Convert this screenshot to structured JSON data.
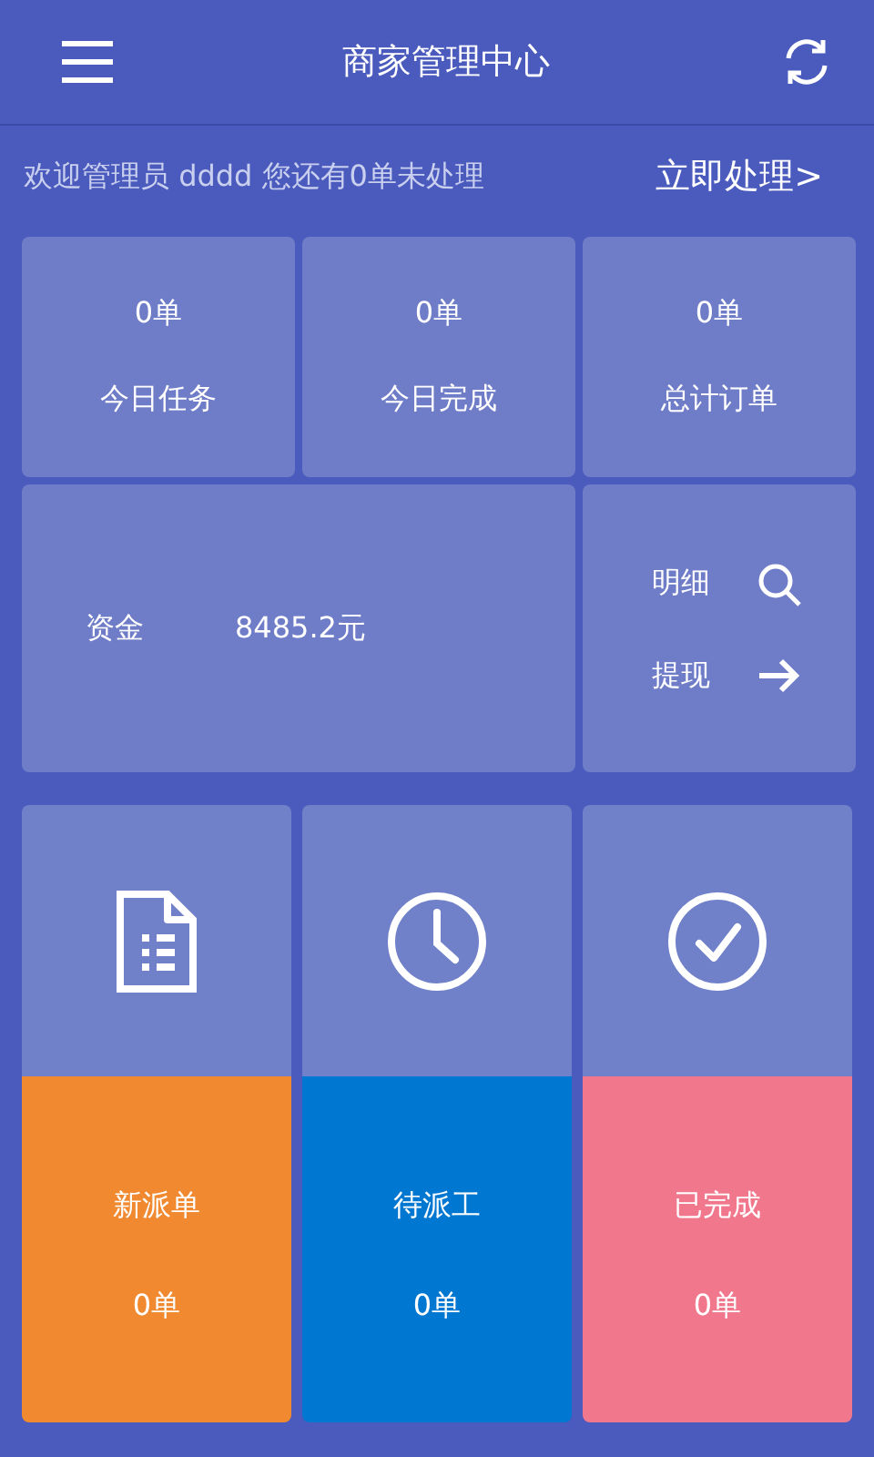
{
  "header": {
    "title": "商家管理中心"
  },
  "notice": {
    "text": "欢迎管理员 dddd 您还有0单未处理",
    "action": "立即处理>"
  },
  "stats": [
    {
      "value": "0单",
      "label": "今日任务"
    },
    {
      "value": "0单",
      "label": "今日完成"
    },
    {
      "value": "0单",
      "label": "总计订单"
    }
  ],
  "funds": {
    "label": "资金",
    "amount": "8485.2元",
    "links": [
      {
        "label": "明细",
        "kind": "search"
      },
      {
        "label": "提现",
        "kind": "arrow"
      }
    ]
  },
  "tiles": [
    {
      "kind": "document",
      "label": "新派单",
      "count": "0单",
      "color": "#f0892f"
    },
    {
      "kind": "clock",
      "label": "待派工",
      "count": "0单",
      "color": "#0077d0"
    },
    {
      "kind": "check",
      "label": "已完成",
      "count": "0单",
      "color": "#f1778d"
    }
  ]
}
